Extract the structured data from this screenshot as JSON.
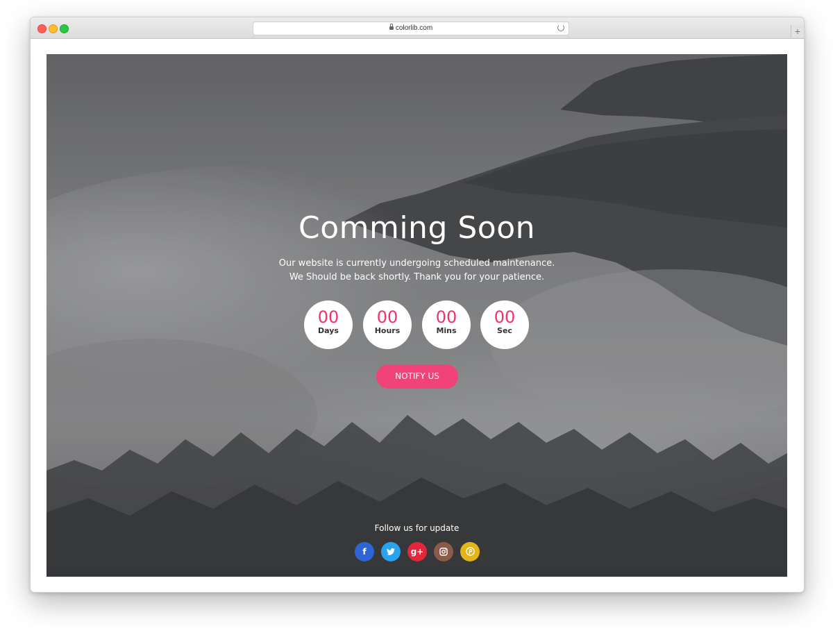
{
  "browser": {
    "url": "colorlib.com",
    "new_tab_symbol": "+"
  },
  "page": {
    "title": "Comming Soon",
    "subtitle_line1": "Our website is currently undergoing scheduled maintenance.",
    "subtitle_line2": "We Should be back shortly. Thank you for your patience.",
    "countdown": [
      {
        "value": "00",
        "label": "Days"
      },
      {
        "value": "00",
        "label": "Hours"
      },
      {
        "value": "00",
        "label": "Mins"
      },
      {
        "value": "00",
        "label": "Sec"
      }
    ],
    "notify_label": "NOTIFY US",
    "follow_label": "Follow us for update",
    "social": [
      {
        "name": "facebook",
        "glyph": "f",
        "color": "#2d65d6"
      },
      {
        "name": "twitter",
        "glyph": "t",
        "color": "#2aa3ef"
      },
      {
        "name": "google-plus",
        "glyph": "g+",
        "color": "#e4263b"
      },
      {
        "name": "instagram",
        "glyph": "◎",
        "color": "#8a5a4a"
      },
      {
        "name": "pinterest",
        "glyph": "p",
        "color": "#e4b51a"
      }
    ]
  },
  "colors": {
    "accent": "#f0437a",
    "countdown_number": "#f0326d"
  }
}
